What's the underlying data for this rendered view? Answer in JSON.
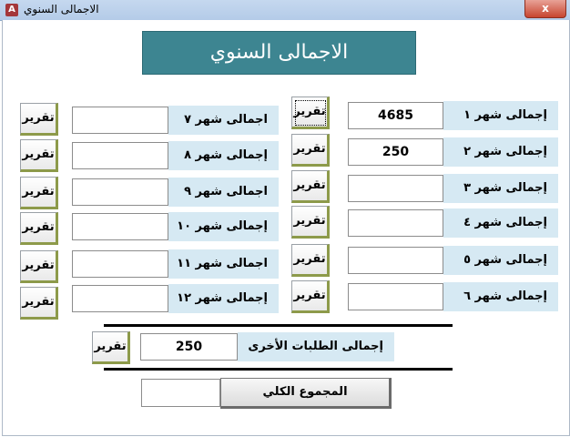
{
  "window": {
    "title": "الاجمالى السنوي",
    "close_label": "x"
  },
  "header": {
    "title": "الاجمالى  السنوي"
  },
  "report_label": "تقرير",
  "months_right": [
    {
      "label": "إجمالى شهر ١",
      "value": "4685"
    },
    {
      "label": "إجمالى شهر ٢",
      "value": "250"
    },
    {
      "label": "إجمالى شهر ٣",
      "value": ""
    },
    {
      "label": "إجمالى شهر ٤",
      "value": ""
    },
    {
      "label": "إجمالى شهر ٥",
      "value": ""
    },
    {
      "label": "إجمالى شهر ٦",
      "value": ""
    }
  ],
  "months_left": [
    {
      "label": "اجمالى شهر ٧",
      "value": ""
    },
    {
      "label": "إجمالى شهر ٨",
      "value": ""
    },
    {
      "label": "اجمالى شهر ٩",
      "value": ""
    },
    {
      "label": "إجمالى شهر ١٠",
      "value": ""
    },
    {
      "label": "اجمالى شهر ١١",
      "value": ""
    },
    {
      "label": "إجمالى شهر ١٢",
      "value": ""
    }
  ],
  "other_orders": {
    "label": "إجمالى الطلبات الأخرى",
    "value": "250"
  },
  "grand_total": {
    "button_label": "المجموع الكلي",
    "value": ""
  },
  "colors": {
    "header_bg": "#3d8591",
    "label_bg": "#d6e9f3",
    "button_accent": "#8d9a4a"
  }
}
